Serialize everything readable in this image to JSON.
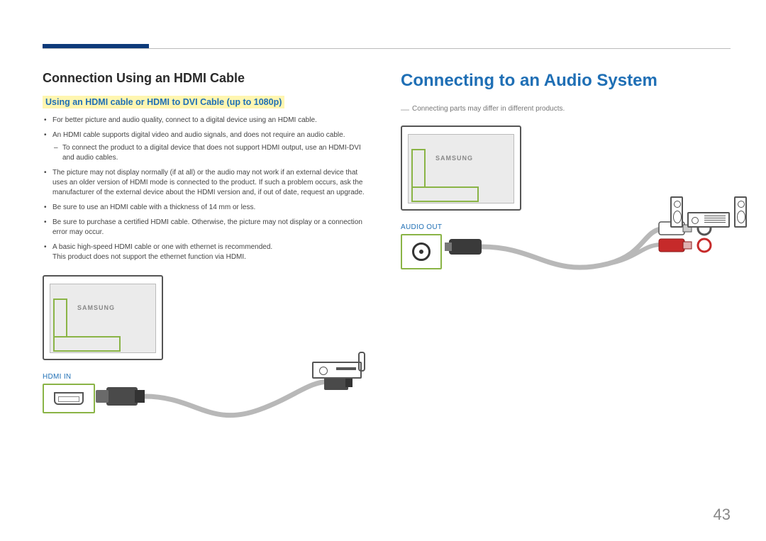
{
  "page_number": "43",
  "left": {
    "heading": "Connection Using an HDMI Cable",
    "subhead_highlight": "Using an HDMI cable or HDMI to DVI Cable (up to 1080p)",
    "bullets": [
      {
        "text": "For better picture and audio quality, connect to a digital device using an HDMI cable."
      },
      {
        "text": "An HDMI cable supports digital video and audio signals, and does not require an audio cable.",
        "sub": "To connect the product to a digital device that does not support HDMI output, use an HDMI-DVI and audio cables."
      },
      {
        "text": "The picture may not display normally (if at all) or the audio may not work if an external device that uses an older version of HDMI mode is connected to the product. If such a problem occurs, ask the manufacturer of the external device about the HDMI version and, if out of date, request an upgrade."
      },
      {
        "text": "Be sure to use an HDMI cable with a thickness of 14 mm or less."
      },
      {
        "text": "Be sure to purchase a certified HDMI cable. Otherwise, the picture may not display or a connection error may occur."
      },
      {
        "text": "A basic high-speed HDMI cable or one with ethernet is recommended.",
        "tail": "This product does not support the ethernet function via HDMI."
      }
    ],
    "device_brand": "SAMSUNG",
    "port_label": "HDMI IN"
  },
  "right": {
    "heading": "Connecting to an Audio System",
    "note": "Connecting parts may differ in different products.",
    "device_brand": "SAMSUNG",
    "port_label": "AUDIO OUT"
  }
}
